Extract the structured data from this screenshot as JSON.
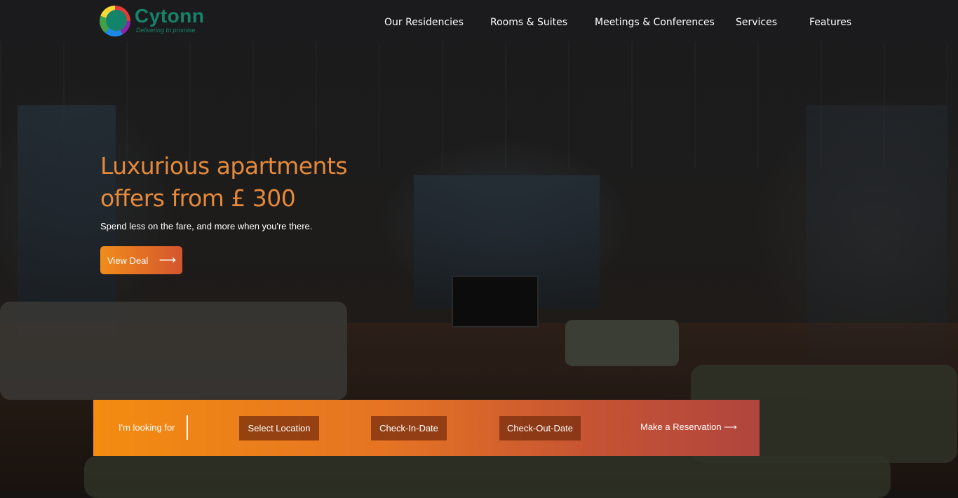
{
  "brand": {
    "name": "Cytonn",
    "tagline": "Delivering to promise",
    "color": "#17826a"
  },
  "nav": {
    "items": [
      {
        "label": "Our Residencies"
      },
      {
        "label": "Rooms & Suites"
      },
      {
        "label": "Meetings & Conferences"
      },
      {
        "label": "Services"
      },
      {
        "label": "Features"
      }
    ]
  },
  "hero": {
    "headline": "Luxurious apartments offers from £ 300",
    "subline": "Spend less on the fare, and more when you're there.",
    "cta_label": "View Deal",
    "cta_arrow": "⟶",
    "accent_color": "#e5893a"
  },
  "booking": {
    "prompt": "I'm looking for",
    "location_label": "Select Location",
    "checkin_label": "Check-In-Date",
    "checkout_label": "Check-Out-Date",
    "reserve_label": "Make a Reservation ⟶"
  }
}
